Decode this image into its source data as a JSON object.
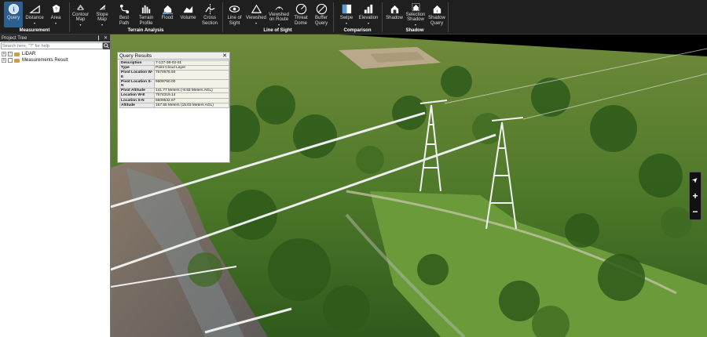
{
  "ribbon": {
    "tools": [
      {
        "id": "query",
        "label": "Query",
        "icon": "query-icon",
        "active": true
      },
      {
        "id": "distance",
        "label": "Distance",
        "icon": "distance-icon",
        "dropdown": true
      },
      {
        "id": "area",
        "label": "Area",
        "icon": "area-icon",
        "dropdown": true
      },
      {
        "id": "contour",
        "label": "Contour Map",
        "icon": "contour-icon",
        "dropdown": true
      },
      {
        "id": "slope",
        "label": "Slope Map",
        "icon": "slope-icon",
        "dropdown": true
      },
      {
        "id": "bestpath",
        "label": "Best Path",
        "icon": "best-path-icon"
      },
      {
        "id": "terrainprofile",
        "label": "Terrain Profile",
        "icon": "terrain-profile-icon"
      },
      {
        "id": "flood",
        "label": "Flood",
        "icon": "flood-icon"
      },
      {
        "id": "volume",
        "label": "Volume",
        "icon": "volume-icon"
      },
      {
        "id": "crosssection",
        "label": "Cross Section",
        "icon": "cross-section-icon"
      },
      {
        "id": "lineofsight",
        "label": "Line of Sight",
        "icon": "line-of-sight-icon"
      },
      {
        "id": "viewshed",
        "label": "Viewshed",
        "icon": "viewshed-icon",
        "dropdown": true
      },
      {
        "id": "viewshedroute",
        "label": "Viewshed on Route",
        "icon": "viewshed-route-icon",
        "dropdown": true
      },
      {
        "id": "threatdome",
        "label": "Threat Dome",
        "icon": "threat-dome-icon"
      },
      {
        "id": "bufferquery",
        "label": "Buffer Query",
        "icon": "buffer-query-icon"
      },
      {
        "id": "swipe",
        "label": "Swipe",
        "icon": "swipe-icon",
        "dropdown": true
      },
      {
        "id": "elevation",
        "label": "Elevation",
        "icon": "elevation-icon",
        "dropdown": true
      },
      {
        "id": "shadow",
        "label": "Shadow",
        "icon": "shadow-icon"
      },
      {
        "id": "selectionshadow",
        "label": "Selection Shadow",
        "icon": "selection-shadow-icon",
        "dropdown": true
      },
      {
        "id": "shadowquery",
        "label": "Shadow Query",
        "icon": "shadow-query-icon"
      }
    ],
    "groups": [
      "Measurement",
      "Terrain Analysis",
      "Line of Sight",
      "Comparison",
      "Shadow"
    ]
  },
  "project_tree": {
    "title": "Project Tree",
    "pin": "❙",
    "close": "✕",
    "search_placeholder": "Search here, \"?\" for help",
    "items": [
      "LiDAR",
      "Measurements Result"
    ],
    "expand": "+",
    "check": "✓"
  },
  "query_results": {
    "title": "Query Results",
    "close": "✕",
    "rows": [
      {
        "key": "Description",
        "value": "7-137-38-02-01"
      },
      {
        "key": "Type",
        "value": "Point Cloud Layer"
      },
      {
        "key": "Pivot Location W-E",
        "value": "7574675.93"
      },
      {
        "key": "Pivot Location S-N",
        "value": "5609750.00"
      },
      {
        "key": "Pivot Altitude",
        "value": "141.77 Meters (-8.93 Meters AGL)"
      },
      {
        "key": "Location W-E",
        "value": "7574319.14"
      },
      {
        "key": "Location S-N",
        "value": "5609532.67"
      },
      {
        "key": "Altitude",
        "value": "167.65 Meters (15.03 Meters AGL)"
      }
    ]
  },
  "navigator": {
    "compass": "➤",
    "zoom_in": "+",
    "zoom_out": "−"
  },
  "colors": {
    "ribbon_bg": "#1f1f1f",
    "active_tool": "#2d5f8f",
    "tree_bg": "#ffffff"
  }
}
